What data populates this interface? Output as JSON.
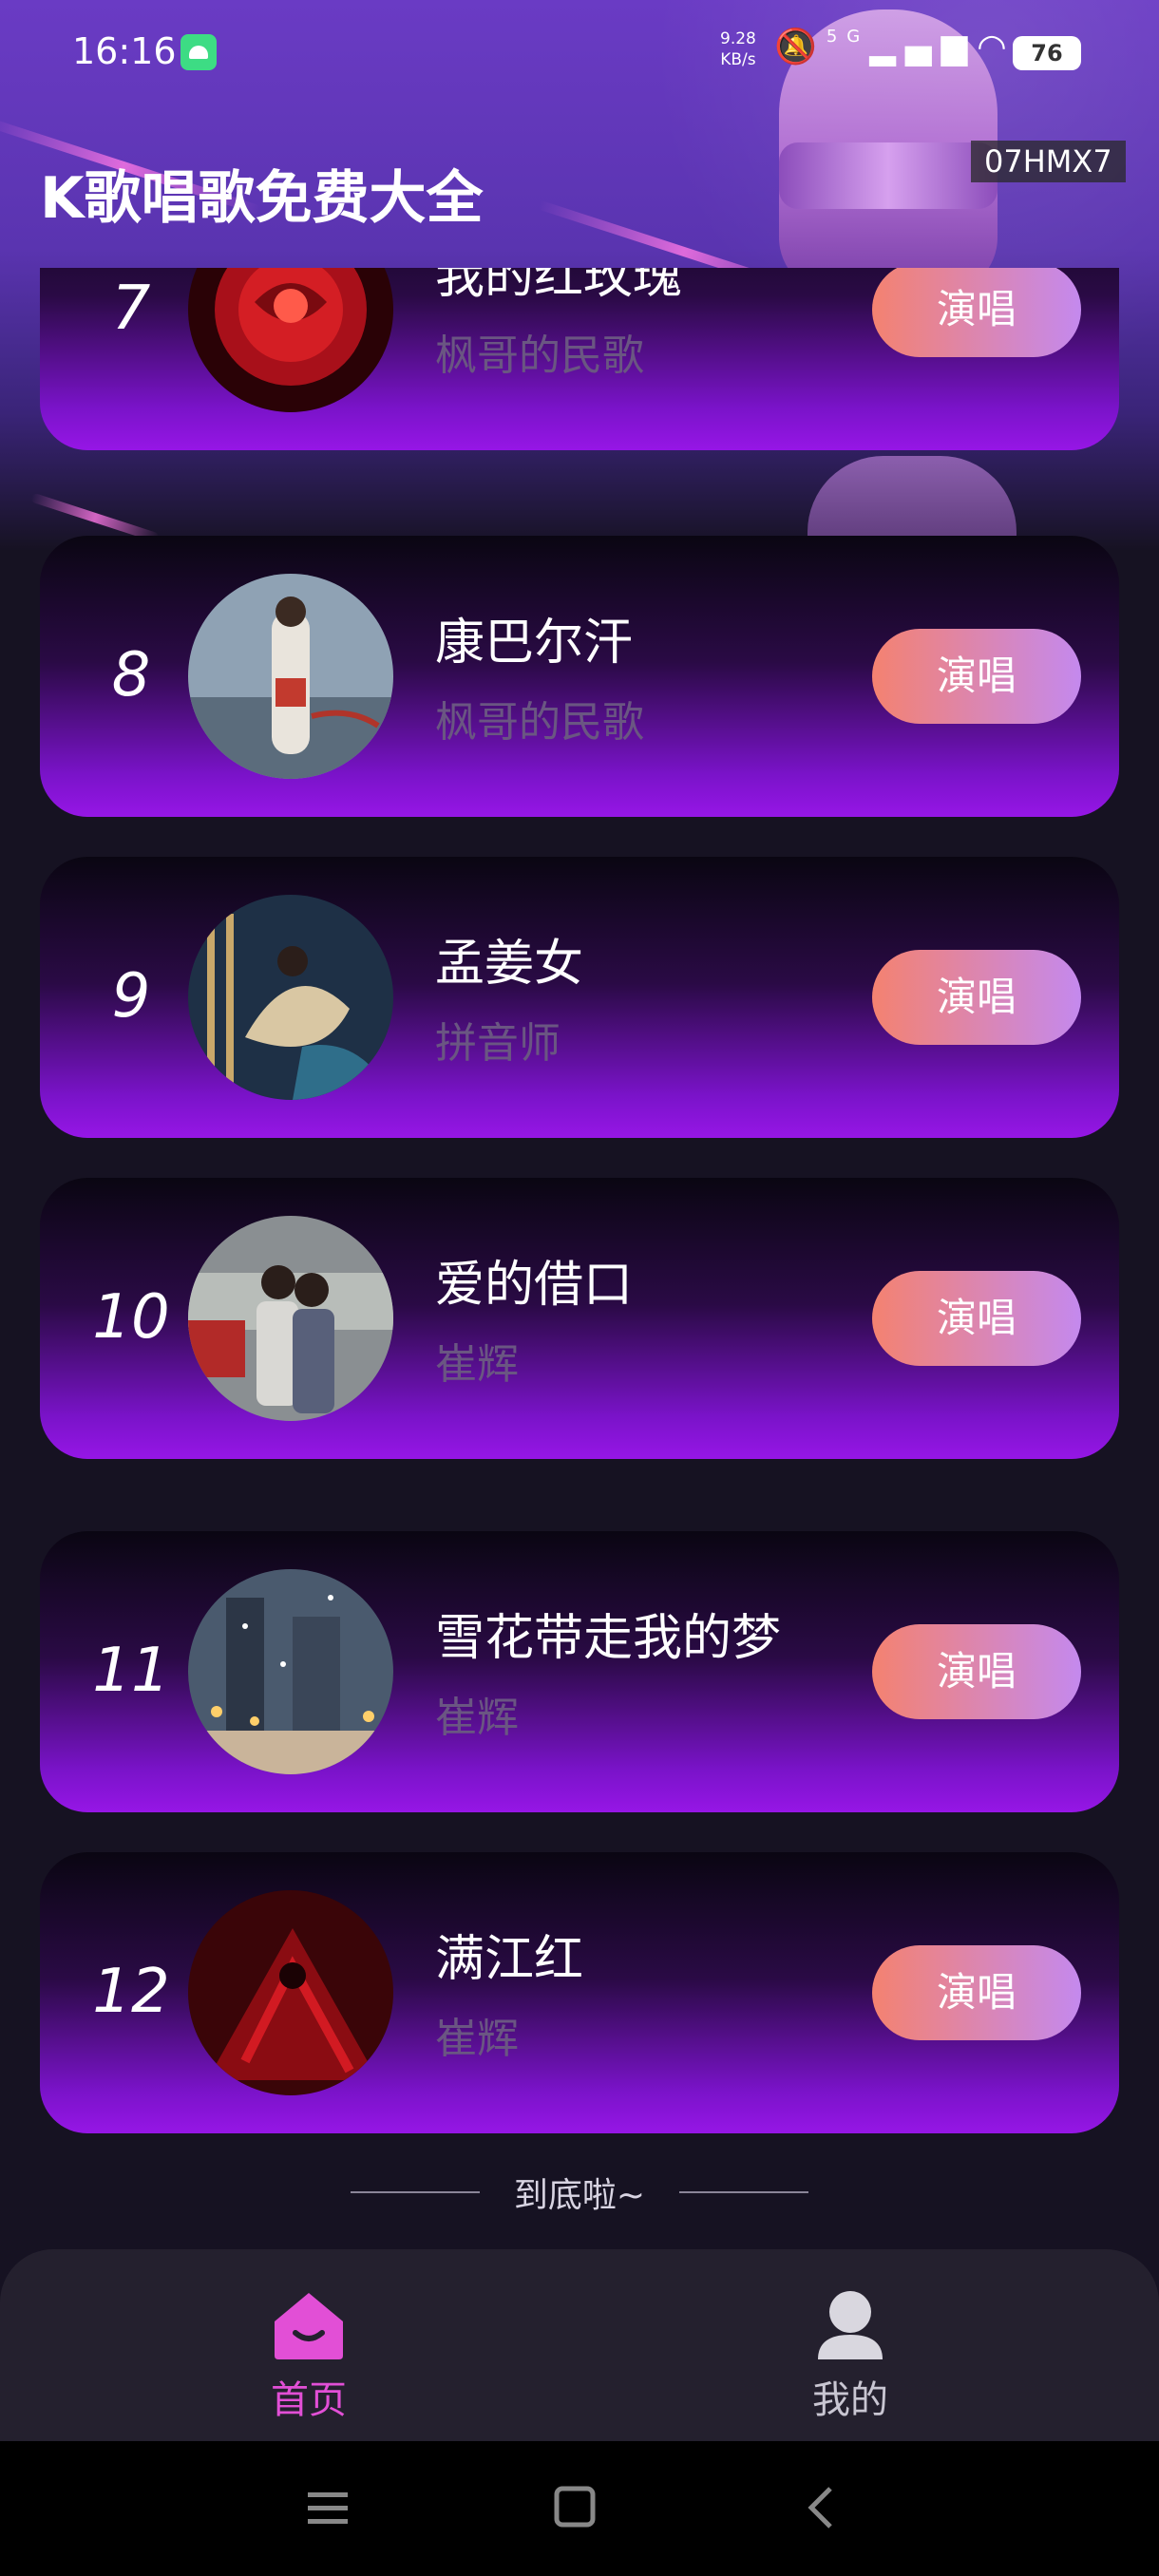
{
  "status_bar": {
    "time": "16:16",
    "net_speed_value": "9.28",
    "net_speed_unit": "KB/s",
    "signal_label": "5G",
    "battery": "76"
  },
  "header": {
    "title": "K歌唱歌免费大全",
    "watermark": "07HMX7"
  },
  "songs": [
    {
      "rank": "7",
      "title": "我的红玫瑰",
      "artist": "枫哥的民歌",
      "button": "演唱"
    },
    {
      "rank": "8",
      "title": "康巴尔汗",
      "artist": "枫哥的民歌",
      "button": "演唱"
    },
    {
      "rank": "9",
      "title": "孟姜女",
      "artist": "拼音师",
      "button": "演唱"
    },
    {
      "rank": "10",
      "title": "爱的借口",
      "artist": "崔辉",
      "button": "演唱"
    },
    {
      "rank": "11",
      "title": "雪花带走我的梦",
      "artist": "崔辉",
      "button": "演唱"
    },
    {
      "rank": "12",
      "title": "满江红",
      "artist": "崔辉",
      "button": "演唱"
    }
  ],
  "list_end_text": "到底啦~",
  "bottom_nav": {
    "home_label": "首页",
    "mine_label": "我的",
    "active": "home"
  },
  "colors": {
    "accent": "#e24fd6",
    "button_start": "#f48270",
    "button_end": "#c489ee"
  }
}
